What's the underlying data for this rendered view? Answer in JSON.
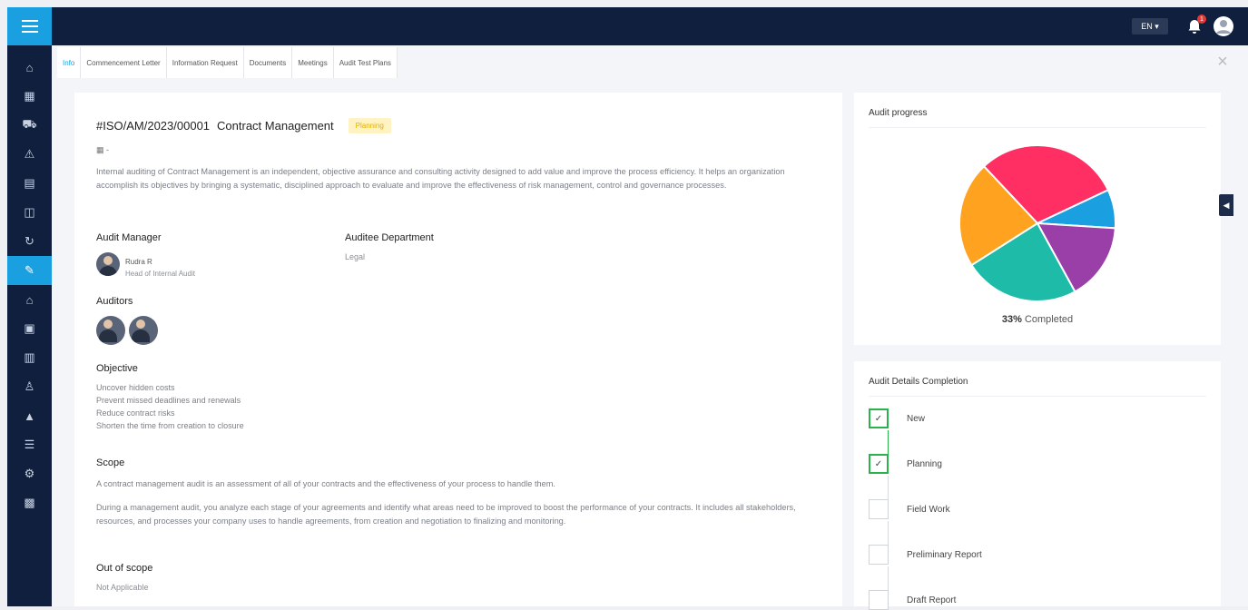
{
  "topbar": {
    "lang": "EN",
    "notifications": "1"
  },
  "tabs": [
    {
      "label": "Info"
    },
    {
      "label": "Commencement Letter"
    },
    {
      "label": "Information Request"
    },
    {
      "label": "Documents"
    },
    {
      "label": "Meetings"
    },
    {
      "label": "Audit Test Plans"
    }
  ],
  "audit": {
    "id": "#ISO/AM/2023/00001",
    "title": "Contract Management",
    "status": "Planning",
    "date": "-",
    "description": "Internal auditing of Contract Management is an independent, objective assurance and consulting activity designed to add value and improve the process efficiency. It helps an organization accomplish its objectives by bringing a systematic, disciplined approach to evaluate and improve the effectiveness of risk management, control and governance processes.",
    "manager_label": "Audit Manager",
    "manager_name": "Rudra R",
    "manager_role": "Head of Internal Audit",
    "department_label": "Auditee Department",
    "department": "Legal",
    "auditors_label": "Auditors",
    "objective_label": "Objective",
    "objectives": [
      "Uncover hidden costs",
      "Prevent missed deadlines and renewals",
      "Reduce contract risks",
      "Shorten the time from creation to closure"
    ],
    "scope_label": "Scope",
    "scope_1": "A contract management audit is an assessment of all of your contracts and the effectiveness of your process to handle them.",
    "scope_2": "During a management audit, you analyze each stage of your agreements and identify what areas need to be improved to boost the performance of your contracts. It includes all stakeholders, resources, and processes your company uses to handle agreements, from creation and negotiation to finalizing and monitoring.",
    "out_of_scope_label": "Out of scope",
    "out_of_scope": "Not Applicable"
  },
  "progress": {
    "title": "Audit progress",
    "percent": "33%",
    "caption": "Completed",
    "slices": [
      {
        "value": 30,
        "color": "#ff2e63"
      },
      {
        "value": 8,
        "color": "#1aa0e0"
      },
      {
        "value": 16,
        "color": "#9b3fa8"
      },
      {
        "value": 24,
        "color": "#1dbba8"
      },
      {
        "value": 22,
        "color": "#ffa21f"
      }
    ]
  },
  "completion": {
    "title": "Audit Details Completion",
    "steps": [
      {
        "label": "New",
        "done": true
      },
      {
        "label": "Planning",
        "done": true
      },
      {
        "label": "Field Work",
        "done": false
      },
      {
        "label": "Preliminary Report",
        "done": false
      },
      {
        "label": "Draft Report",
        "done": false
      }
    ]
  }
}
